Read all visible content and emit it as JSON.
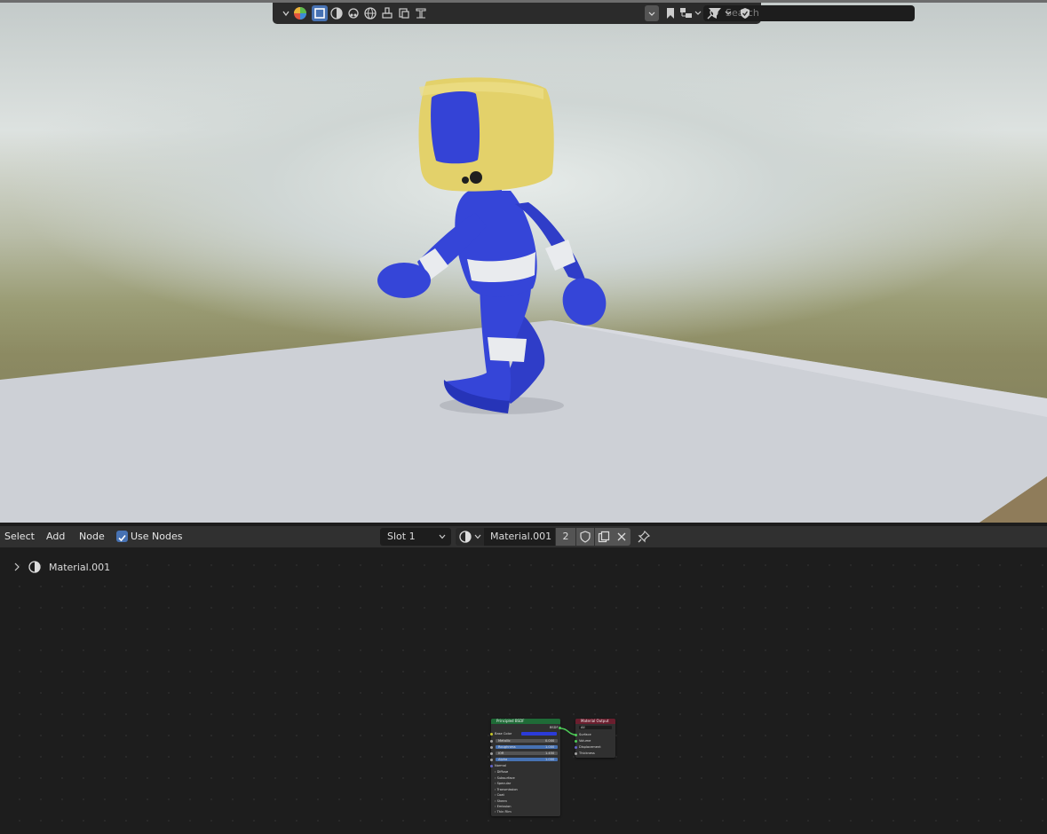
{
  "viewport_header": {
    "search_placeholder": "Search",
    "icons": [
      "chevron-down-icon",
      "material-preview-icon",
      "object-icon",
      "material-icon",
      "light-icon",
      "world-icon",
      "brush-icon",
      "texture-icon",
      "filter-text-icon",
      "search-icon",
      "chevron-down-icon",
      "bookmark-icon",
      "hierarchy-icon",
      "filter-icon",
      "shield-icon"
    ]
  },
  "node_editor": {
    "menus": [
      "Select",
      "Add",
      "Node"
    ],
    "use_nodes_label": "Use Nodes",
    "use_nodes_checked": true,
    "slot": "Slot 1",
    "material_name": "Material.001",
    "user_count": "2",
    "breadcrumb": "Material.001"
  },
  "nodes": {
    "bsdf": {
      "title": "Principled BSDF",
      "output": "BSDF",
      "inputs": [
        {
          "label": "Base Color",
          "value": ""
        },
        {
          "label": "Metallic",
          "value": "0.000"
        },
        {
          "label": "Roughness",
          "value": "1.000"
        },
        {
          "label": "IOR",
          "value": "1.450"
        },
        {
          "label": "Alpha",
          "value": "1.000"
        }
      ],
      "normal_label": "Normal",
      "panels": [
        "Diffuse",
        "Subsurface",
        "Specular",
        "Transmission",
        "Coat",
        "Sheen",
        "Emission",
        "Thin Film"
      ],
      "base_color": "#2b3bd9"
    },
    "output": {
      "title": "Material Output",
      "target": "All",
      "sockets": [
        "Surface",
        "Volume",
        "Displacement",
        "Thickness"
      ]
    }
  },
  "colors": {
    "accent": "#4772b3",
    "character_blue": "#3545d8",
    "tv_yellow": "#e3d16a",
    "stripe_white": "#e9ebee",
    "shader_header": "#1f6b37",
    "output_header": "#6b1e2e",
    "link_green": "#4dcc58"
  }
}
